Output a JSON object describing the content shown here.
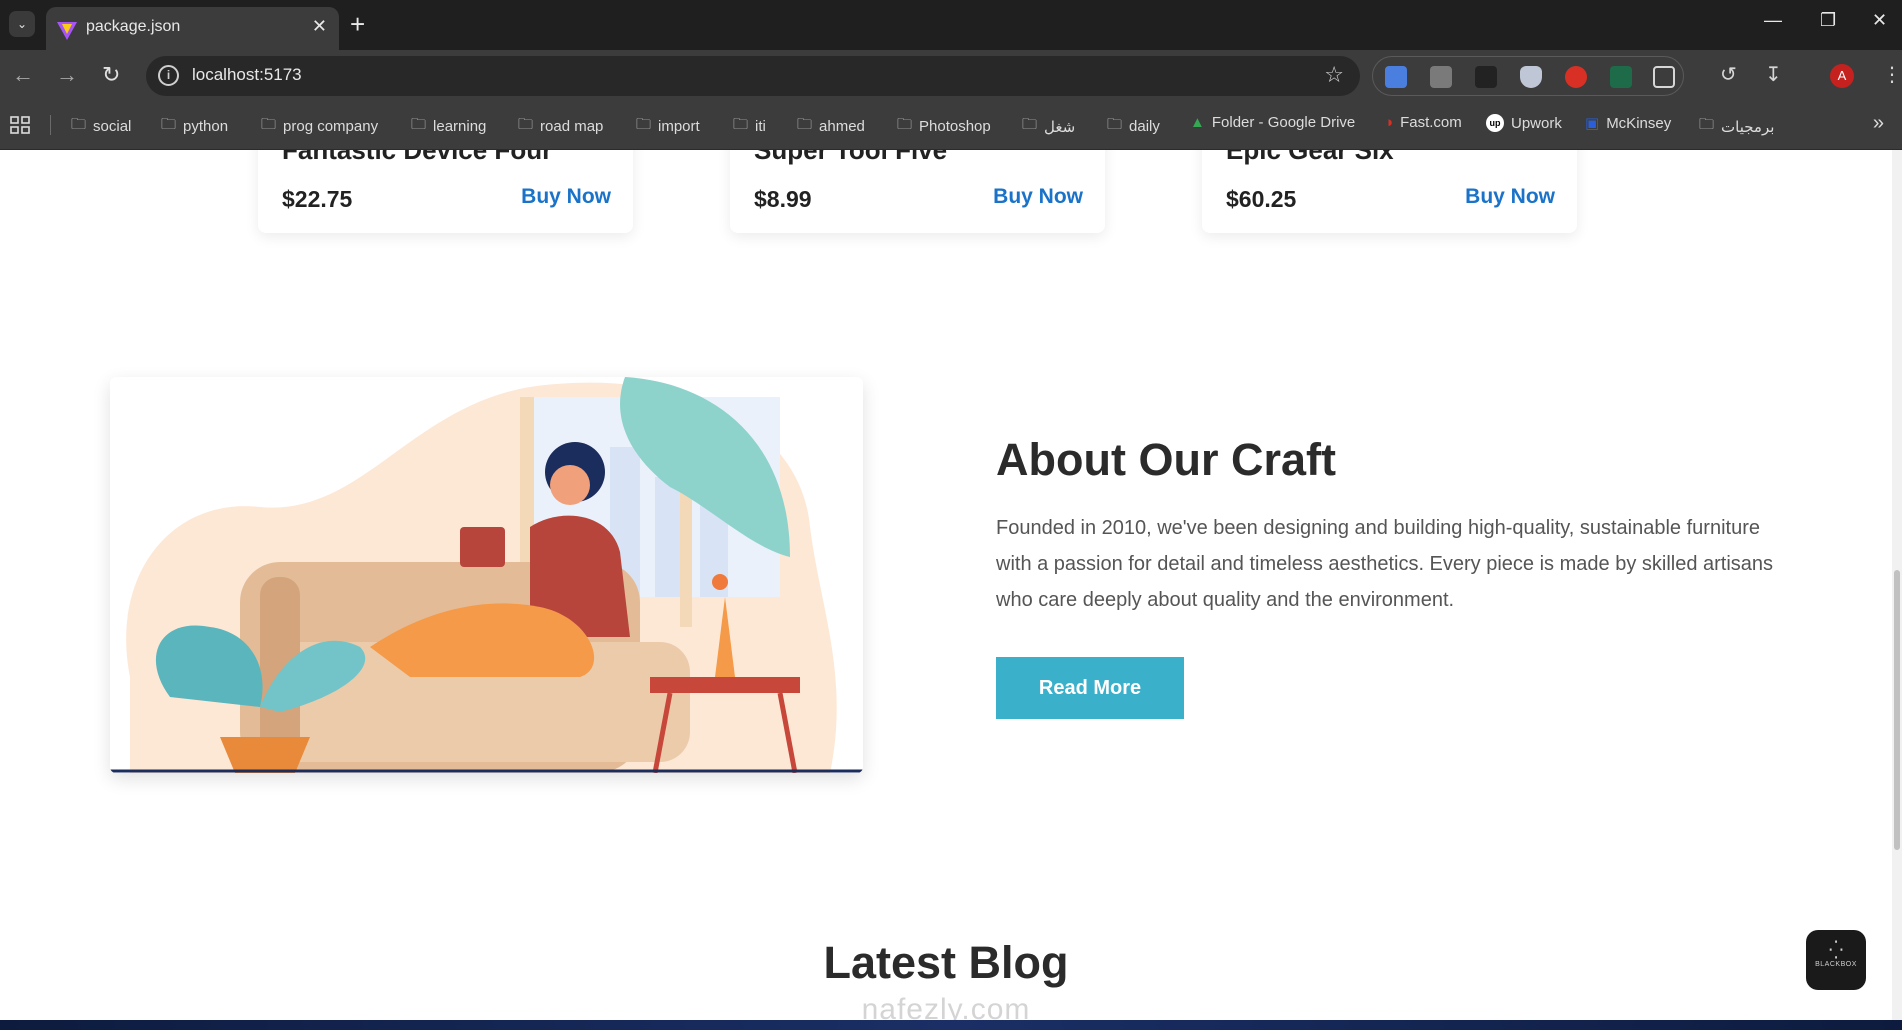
{
  "browser": {
    "tab_title": "package.json",
    "url": "localhost:5173",
    "avatar_letter": "A"
  },
  "bookmarks": [
    {
      "label": "social",
      "icon": "folder-icon"
    },
    {
      "label": "python",
      "icon": "folder-icon"
    },
    {
      "label": "prog company",
      "icon": "folder-icon"
    },
    {
      "label": "learning",
      "icon": "folder-icon"
    },
    {
      "label": "road map",
      "icon": "folder-icon"
    },
    {
      "label": "import",
      "icon": "folder-icon"
    },
    {
      "label": "iti",
      "icon": "folder-icon"
    },
    {
      "label": "ahmed",
      "icon": "folder-icon"
    },
    {
      "label": "Photoshop",
      "icon": "folder-icon"
    },
    {
      "label": "شغل",
      "icon": "folder-icon"
    },
    {
      "label": "daily",
      "icon": "folder-icon"
    },
    {
      "label": "Folder - Google Drive",
      "icon": "google-drive-icon"
    },
    {
      "label": "Fast.com",
      "icon": "fast-icon"
    },
    {
      "label": "Upwork",
      "icon": "upwork-icon"
    },
    {
      "label": "McKinsey",
      "icon": "mckinsey-icon"
    },
    {
      "label": "برمجيات",
      "icon": "folder-icon"
    }
  ],
  "products": [
    {
      "name": "Fantastic Device Four",
      "price": "$22.75",
      "cta": "Buy Now"
    },
    {
      "name": "Super Tool Five",
      "price": "$8.99",
      "cta": "Buy Now"
    },
    {
      "name": "Epic Gear Six",
      "price": "$60.25",
      "cta": "Buy Now"
    }
  ],
  "about": {
    "title": "About Our Craft",
    "text": "Founded in 2010, we've been designing and building high-quality, sustainable furniture with a passion for detail and timeless aesthetics. Every piece is made by skilled artisans who care deeply about quality and the environment.",
    "button": "Read More"
  },
  "blog": {
    "title": "Latest Blog"
  },
  "watermark": "nafezly.com",
  "chat_widget": {
    "label": "BLACKBOX"
  },
  "colors": {
    "accent": "#3ab0cb",
    "link": "#1a73c8"
  }
}
